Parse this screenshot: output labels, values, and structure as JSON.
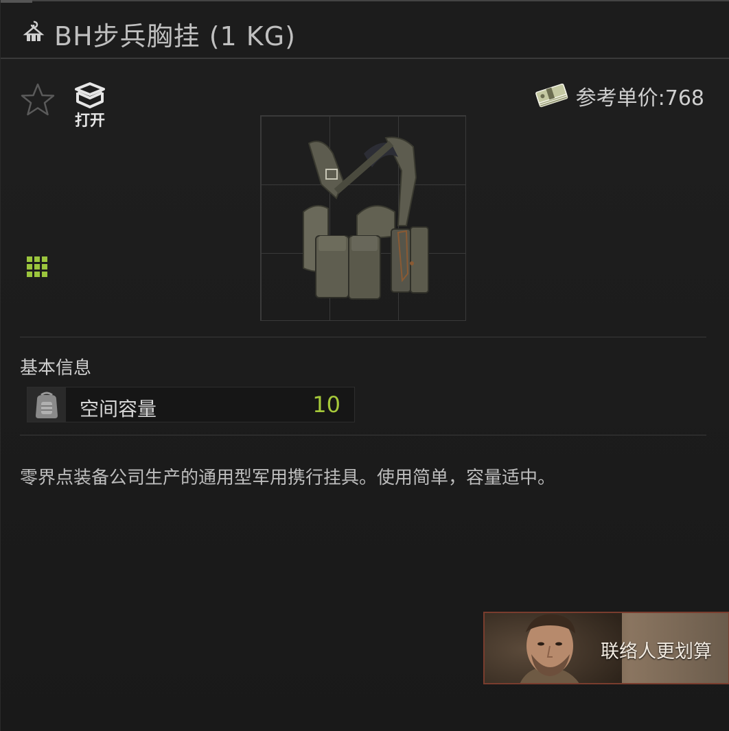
{
  "window": {
    "title": "BH步兵胸挂 (1 KG)",
    "title_icon": "vest-hanger-icon"
  },
  "actions": {
    "favorite_icon": "star-outline-icon",
    "open_icon": "open-box-icon",
    "open_label": "打开"
  },
  "price": {
    "icon": "cash-stack-icon",
    "label": "参考单价:768"
  },
  "item": {
    "image": "chest-rig-image",
    "grid_size_icon": "grid-size-icon",
    "accent_color": "#9bc53d"
  },
  "basic_info": {
    "section_title": "基本信息",
    "stats": [
      {
        "icon": "backpack-icon",
        "label": "空间容量",
        "value": "10"
      }
    ]
  },
  "description": "零界点装备公司生产的通用型军用携行挂具。使用简单，容量适中。",
  "contact_banner": {
    "label": "联络人更划算",
    "border_color": "#7a3d2e"
  }
}
